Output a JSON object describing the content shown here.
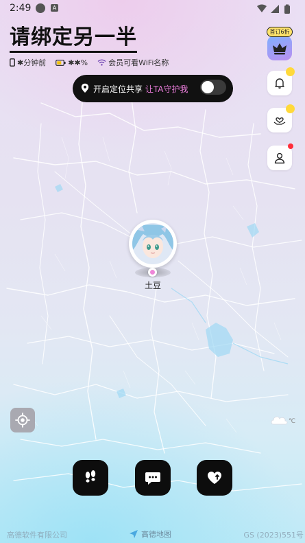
{
  "status_bar": {
    "time": "2:49",
    "indicator_letter": "A"
  },
  "header": {
    "title": "请绑定另一半",
    "last_seen": "✱分钟前",
    "battery": "✱✱%",
    "wifi_text": "会员可看WiFi名称"
  },
  "share": {
    "label": "开启定位共享",
    "highlight": "让TA守护我",
    "toggle_on": false
  },
  "sidebar": {
    "vip_badge": "首订6折"
  },
  "marker": {
    "name": "土豆"
  },
  "weather": {
    "temp": "℃"
  },
  "map_credits": {
    "left": "高德软件有限公司",
    "center": "高德地图",
    "right": "GS (2023)551号"
  },
  "colors": {
    "accent": "#e77bd8",
    "pill_bg": "#111111",
    "vip_badge": "#ffe36b",
    "notification_dot": "#ff2d3a",
    "action_button": "#0d0d0d"
  },
  "icons": {
    "sidebar": [
      "crown-icon",
      "bell-icon",
      "heart-hand-icon",
      "user-icon"
    ],
    "actions": [
      "footprints-icon",
      "chat-icon",
      "heart-plus-icon"
    ]
  }
}
